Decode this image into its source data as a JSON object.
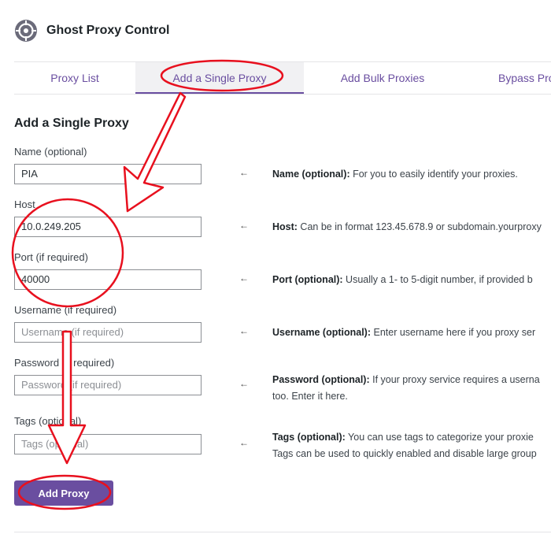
{
  "app": {
    "title": "Ghost Proxy Control"
  },
  "tabs": [
    {
      "label": "Proxy List"
    },
    {
      "label": "Add a Single Proxy"
    },
    {
      "label": "Add Bulk Proxies"
    },
    {
      "label": "Bypass Pro"
    }
  ],
  "form": {
    "section_title": "Add a Single Proxy",
    "name": {
      "label": "Name (optional)",
      "value": "PIA",
      "placeholder": ""
    },
    "host": {
      "label": "Host",
      "value": "10.0.249.205",
      "placeholder": ""
    },
    "port": {
      "label": "Port (if required)",
      "value": "40000",
      "placeholder": ""
    },
    "username": {
      "label": "Username (if required)",
      "value": "",
      "placeholder": "Username (if required)"
    },
    "password": {
      "label": "Password (if required)",
      "value": "",
      "placeholder": "Password (if required)"
    },
    "tags": {
      "label": "Tags (optional)",
      "value": "",
      "placeholder": "Tags (optional)"
    },
    "submit_label": "Add Proxy"
  },
  "help": {
    "arrow_glyph": "←",
    "name": {
      "title": "Name (optional):",
      "text": " For you to easily identify your proxies."
    },
    "host": {
      "title": "Host:",
      "text": " Can be in format 123.45.678.9 or subdomain.yourproxy"
    },
    "port": {
      "title": "Port (optional):",
      "text": " Usually a 1- to 5-digit number, if provided b"
    },
    "username": {
      "title": "Username (optional):",
      "text": " Enter username here if you proxy ser"
    },
    "password": {
      "title": "Password (optional):",
      "text": " If your proxy service requires a userna",
      "line2": "too. Enter it here."
    },
    "tags": {
      "title": "Tags (optional):",
      "text": " You can use tags to categorize your proxie",
      "line2": "Tags can be used to quickly enabled and disable large group"
    }
  },
  "annotation_color": "#e8101e",
  "accent_color": "#6a4ea0"
}
